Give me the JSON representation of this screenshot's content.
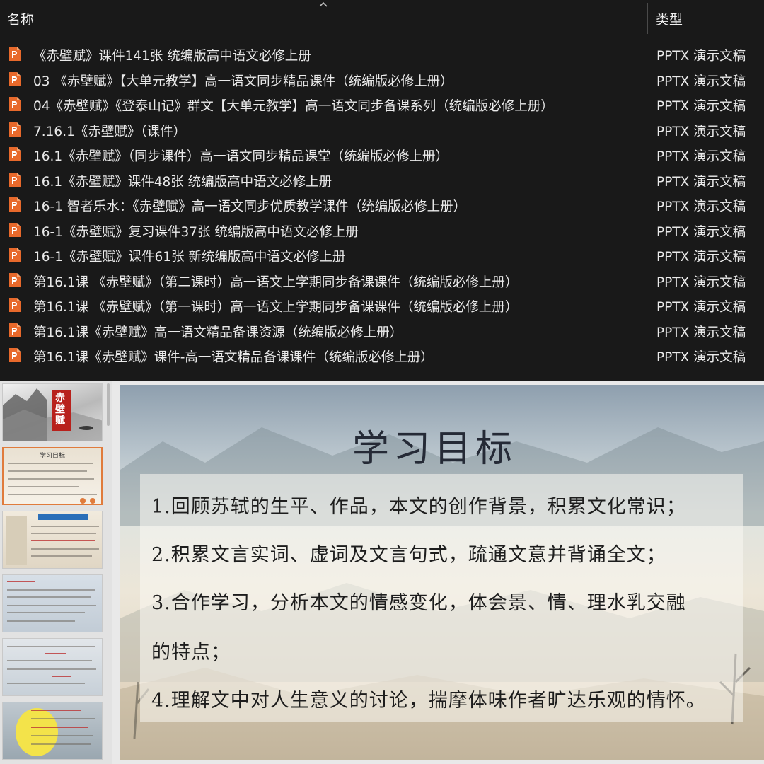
{
  "list": {
    "header_name": "名称",
    "header_type": "类型",
    "files": [
      {
        "name": "《赤壁赋》课件141张 统编版高中语文必修上册",
        "type": "PPTX 演示文稿"
      },
      {
        "name": "03 《赤壁赋》【大单元教学】高一语文同步精品课件（统编版必修上册）",
        "type": "PPTX 演示文稿"
      },
      {
        "name": "04《赤壁赋》《登泰山记》群文【大单元教学】高一语文同步备课系列（统编版必修上册）",
        "type": "PPTX 演示文稿"
      },
      {
        "name": "7.16.1《赤壁赋》（课件）",
        "type": "PPTX 演示文稿"
      },
      {
        "name": "16.1《赤壁赋》（同步课件）高一语文同步精品课堂（统编版必修上册）",
        "type": "PPTX 演示文稿"
      },
      {
        "name": "16.1《赤壁赋》课件48张 统编版高中语文必修上册",
        "type": "PPTX 演示文稿"
      },
      {
        "name": "16-1 智者乐水：《赤壁赋》高一语文同步优质教学课件（统编版必修上册）",
        "type": "PPTX 演示文稿"
      },
      {
        "name": "16-1《赤壁赋》复习课件37张 统编版高中语文必修上册",
        "type": "PPTX 演示文稿"
      },
      {
        "name": "16-1《赤壁赋》课件61张 新统编版高中语文必修上册",
        "type": "PPTX 演示文稿"
      },
      {
        "name": "第16.1课 《赤壁赋》（第二课时）高一语文上学期同步备课课件（统编版必修上册）",
        "type": "PPTX 演示文稿"
      },
      {
        "name": "第16.1课 《赤壁赋》（第一课时）高一语文上学期同步备课课件（统编版必修上册）",
        "type": "PPTX 演示文稿"
      },
      {
        "name": "第16.1课《赤壁赋》高一语文精品备课资源（统编版必修上册）",
        "type": "PPTX 演示文稿"
      },
      {
        "name": "第16.1课《赤壁赋》课件-高一语文精品备课课件（统编版必修上册）",
        "type": "PPTX 演示文稿"
      }
    ]
  },
  "icons": {
    "sort": "chevron-up-icon",
    "file": "pptx-file-icon"
  },
  "colors": {
    "list_bg": "#191919",
    "pptx_icon": "#e8692b",
    "selected_thumb_border": "#e07b3c"
  },
  "slide": {
    "title": "学习目标",
    "objectives": [
      "1.回顾苏轼的生平、作品，本文的创作背景，积累文化常识；",
      "2.积累文言实词、虚词及文言句式，疏通文意并背诵全文；",
      "3.合作学习，分析本文的情感变化，体会景、情、理水乳交融",
      "的特点；",
      "4.理解文中对人生意义的讨论，揣摩体味作者旷达乐观的情怀。"
    ]
  },
  "thumbnails": {
    "count": 6,
    "selected_index": 2,
    "slide1_title": "赤壁赋",
    "slide2_title": "学习目标"
  }
}
